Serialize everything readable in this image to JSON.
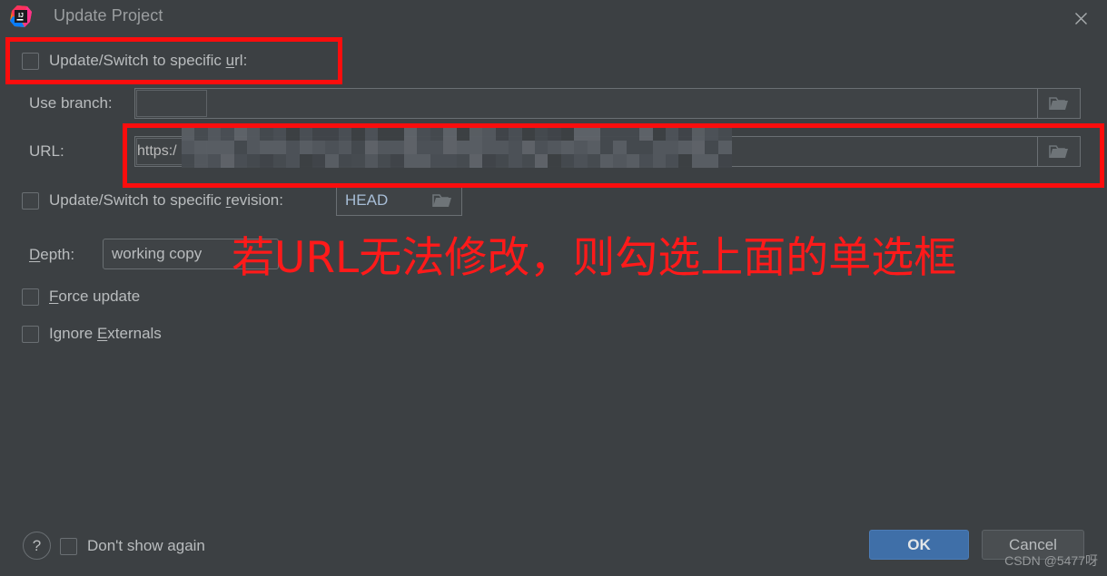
{
  "window": {
    "title": "Update Project",
    "app_icon": "intellij-idea-icon",
    "close_icon": "close-icon",
    "background": "#3c4043"
  },
  "form": {
    "update_switch_url": {
      "label_before": "Update/Switch to specific ",
      "label_accel": "u",
      "label_after": "rl:",
      "checked": false
    },
    "use_branch": {
      "label": "Use branch:",
      "value": "",
      "browse_icon": "folder-icon"
    },
    "url": {
      "label": "URL:",
      "value": "https:/",
      "redacted": true,
      "browse_icon": "folder-icon"
    },
    "update_switch_revision": {
      "label_before": "Update/Switch to specific ",
      "label_accel": "r",
      "label_after": "evision:",
      "checked": false,
      "value": "HEAD",
      "browse_icon": "folder-icon"
    },
    "depth": {
      "label_accel": "D",
      "label_after": "epth:",
      "value": "working copy"
    },
    "force_update": {
      "label_accel": "F",
      "label_after": "orce update",
      "checked": false
    },
    "ignore_externals": {
      "label_before": "Ignore ",
      "label_accel": "E",
      "label_after": "xternals",
      "checked": false
    }
  },
  "annotation": {
    "text": "若URL无法修改，则勾选上面的单选框",
    "color": "#ff1a1a",
    "highlight_color": "#fb0d0d"
  },
  "footer": {
    "help_label": "?",
    "dont_show_again": {
      "label": "Don't show again",
      "checked": false
    },
    "ok_label": "OK",
    "cancel_label": "Cancel",
    "ok_color": "#3f6fa8"
  },
  "watermark": {
    "text": "CSDN @5477呀"
  }
}
